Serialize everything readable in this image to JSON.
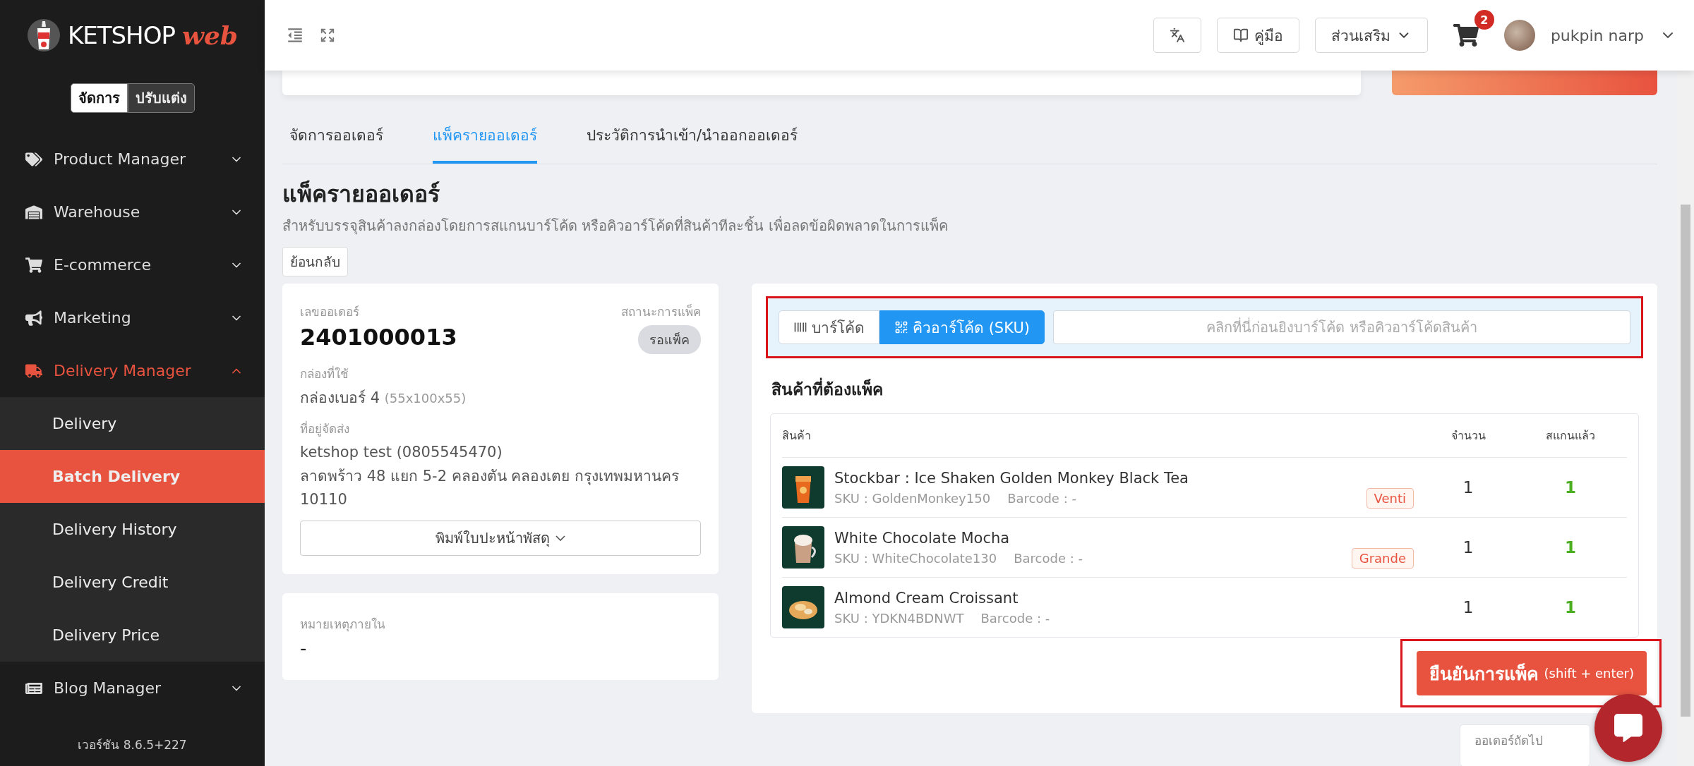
{
  "sidebar": {
    "logo": {
      "text": "KETSHOP",
      "accent": "web"
    },
    "modes": [
      {
        "label": "จัดการ",
        "selected": true
      },
      {
        "label": "ปรับแต่ง",
        "selected": false
      }
    ],
    "items": [
      {
        "label": "Product Manager",
        "expanded": false,
        "active": false
      },
      {
        "label": "Warehouse",
        "expanded": false,
        "active": false
      },
      {
        "label": "E-commerce",
        "expanded": false,
        "active": false
      },
      {
        "label": "Marketing",
        "expanded": false,
        "active": false
      },
      {
        "label": "Delivery Manager",
        "expanded": true,
        "active": true,
        "children": [
          {
            "label": "Delivery",
            "selected": false
          },
          {
            "label": "Batch Delivery",
            "selected": true
          },
          {
            "label": "Delivery History",
            "selected": false
          },
          {
            "label": "Delivery Credit",
            "selected": false
          },
          {
            "label": "Delivery Price",
            "selected": false
          }
        ]
      },
      {
        "label": "Blog Manager",
        "expanded": false,
        "active": false
      }
    ],
    "version": "เวอร์ชัน 8.6.5+227"
  },
  "header": {
    "guide": "คู่มือ",
    "addons": "ส่วนเสริม",
    "cart_count": "2",
    "user": "pukpin narp"
  },
  "tabs": [
    {
      "label": "จัดการออเดอร์",
      "selected": false
    },
    {
      "label": "แพ็ครายออเดอร์",
      "selected": true
    },
    {
      "label": "ประวัติการนำเข้า/นำออกออเดอร์",
      "selected": false
    }
  ],
  "page": {
    "title": "แพ็ครายออเดอร์",
    "subtitle": "สำหรับบรรจุสินค้าลงกล่องโดยการสแกนบาร์โค้ด หรือคิวอาร์โค้ดที่สินค้าทีละชิ้น เพื่อลดข้อผิดพลาดในการแพ็ค",
    "back": "ย้อนกลับ"
  },
  "order": {
    "number_label": "เลขออเดอร์",
    "number": "2401000013",
    "status_label": "สถานะการแพ็ค",
    "status": "รอแพ็ค",
    "box_label": "กล่องที่ใช้",
    "box": "กล่องเบอร์ 4",
    "box_size": "(55x100x55)",
    "address_label": "ที่อยู่จัดส่ง",
    "recipient": "ketshop test (0805545470)",
    "address": "ลาดพร้าว 48 แยก 5-2 คลองตัน คลองเตย กรุงเทพมหานคร 10110",
    "print": "พิมพ์ใบปะหน้าพัสดุ"
  },
  "note": {
    "label": "หมายเหตุภายใน",
    "value": "-"
  },
  "scanner": {
    "highlighted": true,
    "modes": [
      {
        "label": "บาร์โค้ด",
        "selected": false
      },
      {
        "label": "คิวอาร์โค้ด (SKU)",
        "selected": true
      }
    ],
    "placeholder": "คลิกที่นี่ก่อนยิงบาร์โค้ด หรือคิวอาร์โค้ดสินค้า"
  },
  "items_title": "สินค้าที่ต้องแพ็ค",
  "table": {
    "columns": [
      "สินค้า",
      "จำนวน",
      "สแกนแล้ว"
    ],
    "rows": [
      {
        "name": "Stockbar : Ice Shaken Golden Monkey Black Tea",
        "sku": "SKU : GoldenMonkey150",
        "barcode": "Barcode : -",
        "variant": "Venti",
        "quantity": "1",
        "scanned": "1"
      },
      {
        "name": "White Chocolate Mocha",
        "sku": "SKU : WhiteChocolate130",
        "barcode": "Barcode : -",
        "variant": "Grande",
        "quantity": "1",
        "scanned": "1"
      },
      {
        "name": "Almond Cream Croissant",
        "sku": "SKU : YDKN4BDNWT",
        "barcode": "Barcode : -",
        "quantity": "1",
        "scanned": "1"
      }
    ]
  },
  "confirm": {
    "label": "ยืนยันการแพ็ค",
    "shortcut": "(shift + enter)",
    "highlighted": true
  },
  "next_order": "ออเดอร์ถัดไป"
}
